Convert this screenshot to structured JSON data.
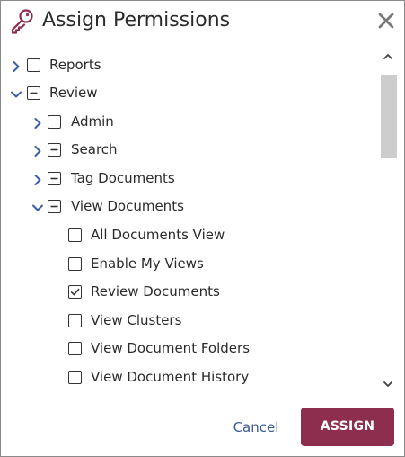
{
  "dialog": {
    "title": "Assign Permissions",
    "title_icon": "key-icon",
    "close_icon": "close-icon"
  },
  "tree": {
    "items": [
      {
        "id": "reports",
        "label": "Reports",
        "level": 0,
        "expander": "collapsed",
        "state": "unchecked"
      },
      {
        "id": "review",
        "label": "Review",
        "level": 0,
        "expander": "expanded",
        "state": "indeterminate"
      },
      {
        "id": "admin",
        "label": "Admin",
        "level": 1,
        "expander": "collapsed",
        "state": "unchecked"
      },
      {
        "id": "search",
        "label": "Search",
        "level": 1,
        "expander": "collapsed",
        "state": "indeterminate"
      },
      {
        "id": "tag-documents",
        "label": "Tag Documents",
        "level": 1,
        "expander": "collapsed",
        "state": "indeterminate"
      },
      {
        "id": "view-documents",
        "label": "View Documents",
        "level": 1,
        "expander": "expanded",
        "state": "indeterminate"
      },
      {
        "id": "all-documents-view",
        "label": "All Documents View",
        "level": 2,
        "expander": "none",
        "state": "unchecked"
      },
      {
        "id": "enable-my-views",
        "label": "Enable My Views",
        "level": 2,
        "expander": "none",
        "state": "unchecked"
      },
      {
        "id": "review-documents",
        "label": "Review Documents",
        "level": 2,
        "expander": "none",
        "state": "checked"
      },
      {
        "id": "view-clusters",
        "label": "View Clusters",
        "level": 2,
        "expander": "none",
        "state": "unchecked"
      },
      {
        "id": "view-document-folders",
        "label": "View Document Folders",
        "level": 2,
        "expander": "none",
        "state": "unchecked"
      },
      {
        "id": "view-document-history",
        "label": "View Document History",
        "level": 2,
        "expander": "none",
        "state": "unchecked"
      }
    ]
  },
  "footer": {
    "cancel_label": "Cancel",
    "assign_label": "ASSIGN"
  },
  "colors": {
    "accent": "#8e2e4f",
    "link": "#3b5998",
    "chevron": "#3d5fa8",
    "text": "#2b2b2b",
    "scroll_thumb": "#cdcdcd"
  }
}
